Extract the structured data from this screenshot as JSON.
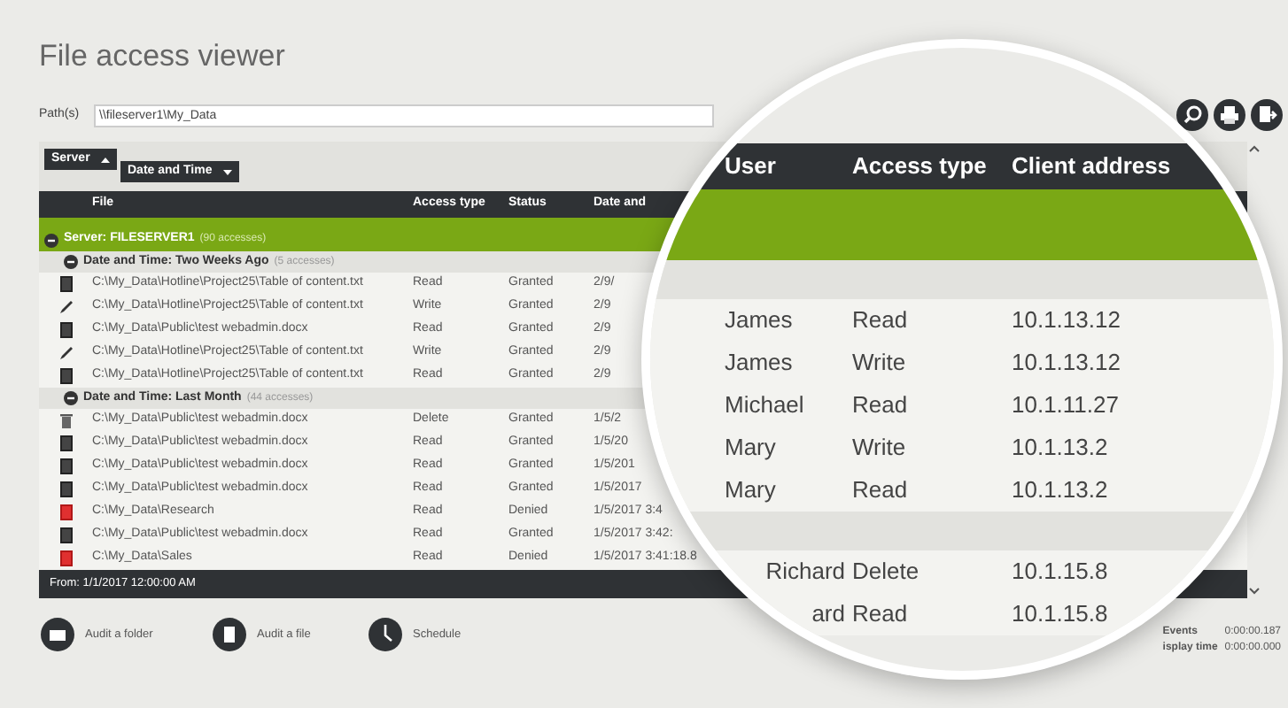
{
  "title": "File access viewer",
  "path": {
    "label": "Path(s)",
    "value": "\\\\fileserver1\\My_Data"
  },
  "grouping": [
    {
      "label": "Server"
    },
    {
      "label": "Date and Time"
    }
  ],
  "table": {
    "columns": [
      "File",
      "Access type",
      "Status",
      "Date and"
    ],
    "server_group": {
      "label": "Server: FILESERVER1",
      "count": "(90 accesses)",
      "expanded": true
    },
    "groups": [
      {
        "label": "Date and Time: Two Weeks Ago",
        "count": "(5 accesses)",
        "expanded": true,
        "rows": [
          {
            "kind": "document",
            "file": "C:\\My_Data\\Hotline\\Project25\\Table of content.txt",
            "access": "Read",
            "status": "Granted",
            "date": "2/9/"
          },
          {
            "kind": "pencil",
            "file": "C:\\My_Data\\Hotline\\Project25\\Table of content.txt",
            "access": "Write",
            "status": "Granted",
            "date": "2/9"
          },
          {
            "kind": "document",
            "file": "C:\\My_Data\\Public\\test webadmin.docx",
            "access": "Read",
            "status": "Granted",
            "date": "2/9"
          },
          {
            "kind": "pencil",
            "file": "C:\\My_Data\\Hotline\\Project25\\Table of content.txt",
            "access": "Write",
            "status": "Granted",
            "date": "2/9"
          },
          {
            "kind": "document",
            "file": "C:\\My_Data\\Hotline\\Project25\\Table of content.txt",
            "access": "Read",
            "status": "Granted",
            "date": "2/9"
          }
        ]
      },
      {
        "label": "Date and Time: Last Month",
        "count": "(44 accesses)",
        "expanded": true,
        "rows": [
          {
            "kind": "trash",
            "file": "C:\\My_Data\\Public\\test webadmin.docx",
            "access": "Delete",
            "status": "Granted",
            "date": "1/5/2"
          },
          {
            "kind": "document",
            "file": "C:\\My_Data\\Public\\test webadmin.docx",
            "access": "Read",
            "status": "Granted",
            "date": "1/5/20"
          },
          {
            "kind": "document",
            "file": "C:\\My_Data\\Public\\test webadmin.docx",
            "access": "Read",
            "status": "Granted",
            "date": "1/5/201"
          },
          {
            "kind": "document",
            "file": "C:\\My_Data\\Public\\test webadmin.docx",
            "access": "Read",
            "status": "Granted",
            "date": "1/5/2017"
          },
          {
            "kind": "denied",
            "file": "C:\\My_Data\\Research",
            "access": "Read",
            "status": "Denied",
            "date": "1/5/2017 3:4"
          },
          {
            "kind": "document",
            "file": "C:\\My_Data\\Public\\test webadmin.docx",
            "access": "Read",
            "status": "Granted",
            "date": "1/5/2017 3:42:"
          },
          {
            "kind": "denied",
            "file": "C:\\My_Data\\Sales",
            "access": "Read",
            "status": "Denied",
            "date": "1/5/2017 3:41:18.8"
          }
        ]
      }
    ],
    "footer": "From: 1/1/2017 12:00:00 AM"
  },
  "actions": [
    "Audit a folder",
    "Audit a file",
    "Schedule"
  ],
  "stats": [
    {
      "label": "Events",
      "value": "0:00:00.187"
    },
    {
      "label": "isplay time",
      "value": "0:00:00.000"
    }
  ],
  "magnifier": {
    "columns": [
      "User",
      "Access type",
      "Client address"
    ],
    "groups": [
      {
        "rows": [
          {
            "user": "James",
            "access": "Read",
            "client": "10.1.13.12"
          },
          {
            "user": "James",
            "access": "Write",
            "client": "10.1.13.12"
          },
          {
            "user": "Michael",
            "access": "Read",
            "client": "10.1.11.27"
          },
          {
            "user": "Mary",
            "access": "Write",
            "client": "10.1.13.2"
          },
          {
            "user": "Mary",
            "access": "Read",
            "client": "10.1.13.2"
          }
        ]
      },
      {
        "rows": [
          {
            "user": "Richard",
            "access": "Delete",
            "client": "10.1.15.8"
          },
          {
            "user": "ard",
            "access": "Read",
            "client": "10.1.15.8"
          }
        ]
      }
    ]
  }
}
